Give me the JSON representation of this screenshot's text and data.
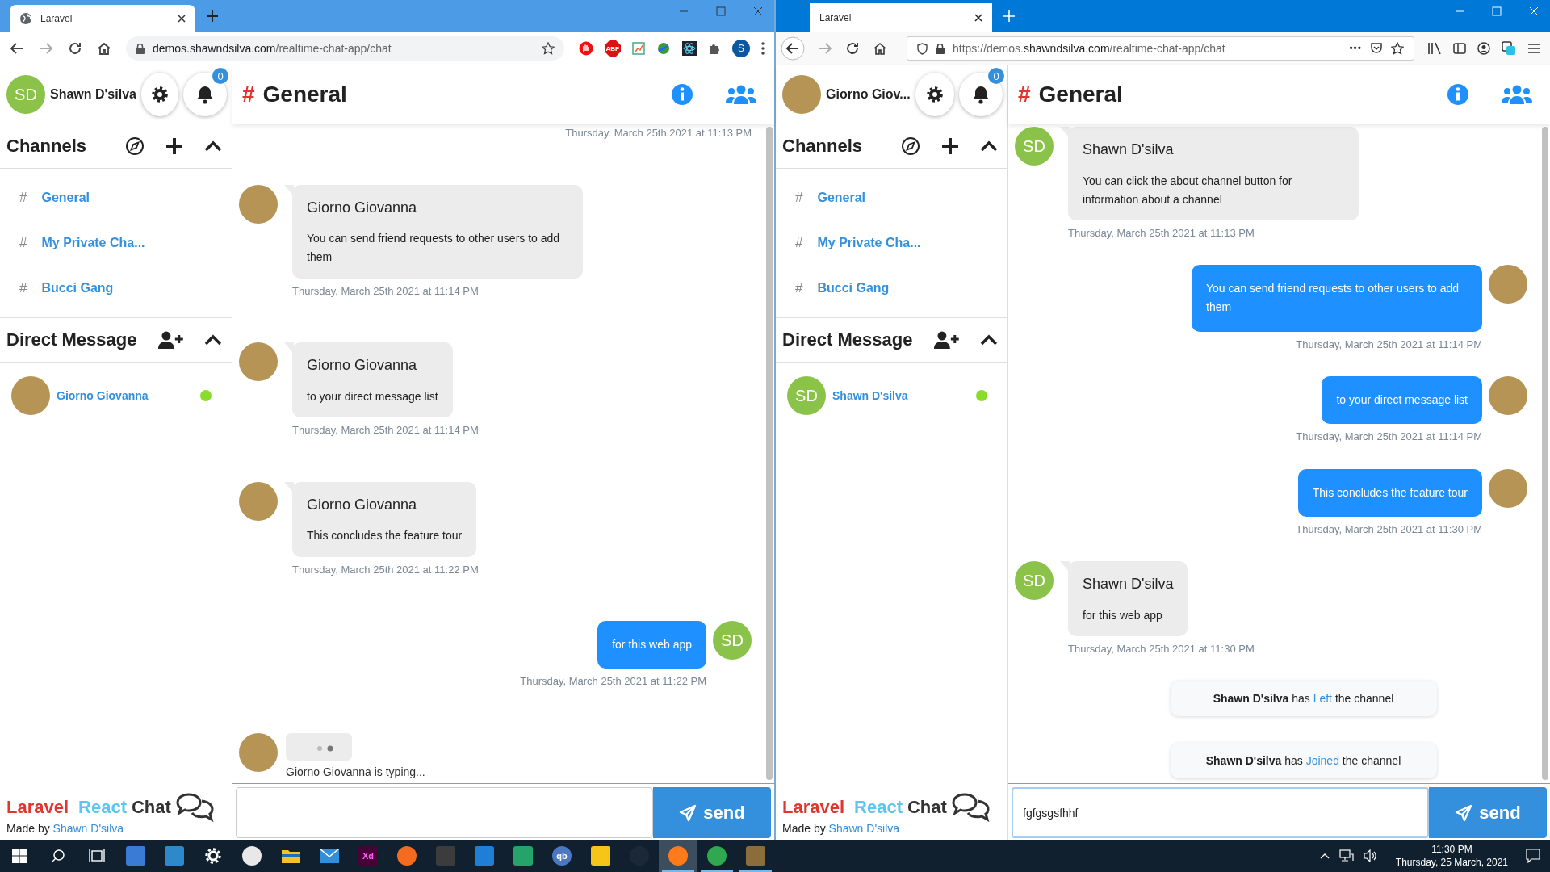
{
  "windows": [
    {
      "kind": "chrome",
      "tab_title": "Laravel",
      "url": [
        {
          "text": "demos.shawndsilva.com",
          "strong": true
        },
        {
          "text": "/realtime-chat-app/chat",
          "strong": false
        }
      ],
      "adblock_label": "ABP",
      "profile_initial": "S",
      "app": {
        "user": {
          "name": "Shawn D'silva",
          "avatar": {
            "kind": "initials",
            "initials": "SD"
          }
        },
        "notification_count": "0",
        "channels_heading": "Channels",
        "channels": [
          {
            "hash": "#",
            "name": "General"
          },
          {
            "hash": "#",
            "name": "My Private Cha..."
          },
          {
            "hash": "#",
            "name": "Bucci Gang"
          }
        ],
        "dm_heading": "Direct Message",
        "direct_messages": [
          {
            "name": "Giorno Giovanna",
            "avatar": {
              "kind": "photo"
            },
            "online": true
          }
        ],
        "brand": {
          "part_1": "Laravel",
          "part_2": "React",
          "part_3": "Chat",
          "made_by": "Made by",
          "author": "Shawn D'silva"
        },
        "channel_hash": "#",
        "channel_title": "General",
        "messages": [
          {
            "kind": "time",
            "time": "Thursday, March 25th 2021 at 11:13 PM"
          },
          {
            "kind": "received",
            "author": "Giorno Giovanna",
            "text": "You can send friend requests to other users to add them",
            "time": "Thursday, March 25th 2021 at 11:14 PM",
            "avatar": {
              "kind": "photo"
            }
          },
          {
            "kind": "received",
            "author": "Giorno Giovanna",
            "text": "to your direct message list",
            "time": "Thursday, March 25th 2021 at 11:14 PM",
            "avatar": {
              "kind": "photo"
            }
          },
          {
            "kind": "received",
            "author": "Giorno Giovanna",
            "text": "This concludes the feature tour",
            "time": "Thursday, March 25th 2021 at 11:22 PM",
            "avatar": {
              "kind": "photo"
            }
          },
          {
            "kind": "sent",
            "text": "for this web app",
            "time": "Thursday, March 25th 2021 at 11:22 PM",
            "avatar": {
              "kind": "initials",
              "initials": "SD"
            }
          },
          {
            "kind": "typing",
            "text": "Giorno Giovanna is typing...",
            "avatar": {
              "kind": "photo"
            }
          }
        ],
        "composer": {
          "send_label": "send"
        }
      }
    },
    {
      "kind": "firefox",
      "tab_title": "Laravel",
      "url": [
        {
          "text": "https://demos.",
          "strong": false
        },
        {
          "text": "shawndsilva.com",
          "strong": true
        },
        {
          "text": "/realtime-chat-app/chat",
          "strong": false
        }
      ],
      "url_more": "•••",
      "app": {
        "user": {
          "name": "Giorno Giov...",
          "avatar": {
            "kind": "photo"
          }
        },
        "notification_count": "0",
        "channels_heading": "Channels",
        "channels": [
          {
            "hash": "#",
            "name": "General"
          },
          {
            "hash": "#",
            "name": "My Private Cha..."
          },
          {
            "hash": "#",
            "name": "Bucci Gang"
          }
        ],
        "dm_heading": "Direct Message",
        "direct_messages": [
          {
            "name": "Shawn D'silva",
            "avatar": {
              "kind": "initials",
              "initials": "SD"
            },
            "online": true
          }
        ],
        "brand": {
          "part_1": "Laravel",
          "part_2": "React",
          "part_3": "Chat",
          "made_by": "Made by",
          "author": "Shawn D'silva"
        },
        "channel_hash": "#",
        "channel_title": "General",
        "messages": [
          {
            "kind": "received",
            "author": "Shawn D'silva",
            "text": "You can click the about channel button for information about a channel",
            "time": "Thursday, March 25th 2021 at 11:13 PM",
            "avatar": {
              "kind": "initials",
              "initials": "SD"
            }
          },
          {
            "kind": "sent",
            "text": "You can send friend requests to other users to add them",
            "time": "Thursday, March 25th 2021 at 11:14 PM",
            "avatar": {
              "kind": "photo"
            }
          },
          {
            "kind": "sent",
            "text": "to your direct message list",
            "time": "Thursday, March 25th 2021 at 11:14 PM",
            "avatar": {
              "kind": "photo"
            }
          },
          {
            "kind": "sent",
            "text": "This concludes the feature tour",
            "time": "Thursday, March 25th 2021 at 11:30 PM",
            "avatar": {
              "kind": "photo"
            }
          },
          {
            "kind": "received",
            "author": "Shawn D'silva",
            "text": "for this web app",
            "time": "Thursday, March 25th 2021 at 11:30 PM",
            "avatar": {
              "kind": "initials",
              "initials": "SD"
            }
          },
          {
            "kind": "event",
            "actor": "Shawn D'silva",
            "verb": "has",
            "action": "Left",
            "rest": "the channel"
          },
          {
            "kind": "event",
            "actor": "Shawn D'silva",
            "verb": "has",
            "action": "Joined",
            "rest": "the channel"
          }
        ],
        "composer": {
          "value": "fgfgsgsfhhf",
          "send_label": "send"
        }
      }
    }
  ],
  "taskbar": {
    "items": [
      {
        "kind": "start",
        "running": false,
        "selected": false
      },
      {
        "kind": "search",
        "running": false,
        "selected": false
      },
      {
        "kind": "taskview",
        "running": false,
        "selected": false
      },
      {
        "kind": "tile",
        "color": "#3a7bd5",
        "running": false,
        "selected": false
      },
      {
        "kind": "tile",
        "color": "#2d89c9",
        "running": false,
        "selected": false
      },
      {
        "kind": "gear",
        "running": false,
        "selected": false
      },
      {
        "kind": "round",
        "color": "#e8e8e8",
        "running": false,
        "selected": false
      },
      {
        "kind": "folder",
        "color": "#f2c12e",
        "running": false,
        "selected": false
      },
      {
        "kind": "mail",
        "color": "#2f8fdd",
        "running": false,
        "selected": false
      },
      {
        "kind": "tile",
        "color": "#470137",
        "label": "Xd",
        "running": false,
        "selected": false
      },
      {
        "kind": "round",
        "color": "#f26b21",
        "running": false,
        "selected": false
      },
      {
        "kind": "tile",
        "color": "#3c3c3c",
        "running": false,
        "selected": false
      },
      {
        "kind": "tile",
        "color": "#1f7fd6",
        "running": false,
        "selected": false
      },
      {
        "kind": "tile",
        "color": "#24a36b",
        "running": false,
        "selected": false
      },
      {
        "kind": "round",
        "color": "#4a78c2",
        "label": "qb",
        "running": false,
        "selected": false
      },
      {
        "kind": "tile",
        "color": "#f5c518",
        "running": false,
        "selected": false
      },
      {
        "kind": "round",
        "color": "#1b2838",
        "running": false,
        "selected": false
      },
      {
        "kind": "round",
        "color": "#ff7a1a",
        "running": true,
        "selected": true
      },
      {
        "kind": "round",
        "color": "#2fa84f",
        "running": true,
        "selected": false
      },
      {
        "kind": "tile",
        "color": "#8a6d3b",
        "running": true,
        "selected": false
      }
    ],
    "time": "11:30 PM",
    "date": "Thursday, 25 March, 2021"
  }
}
